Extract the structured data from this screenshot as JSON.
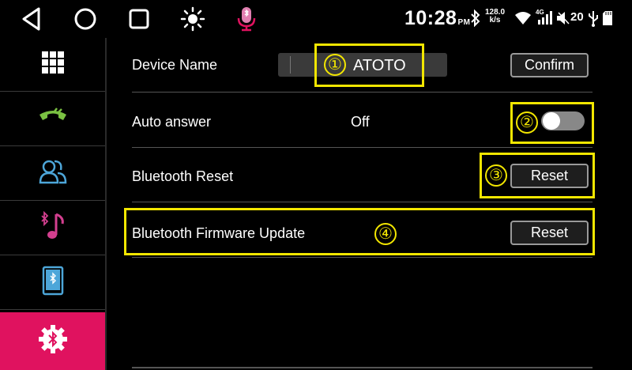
{
  "status_bar": {
    "time": "10:28",
    "ampm": "PM",
    "net_speed_value": "128.0",
    "net_speed_unit": "k/s",
    "signal_label": "4G",
    "volume": "20",
    "icons": [
      "back-icon",
      "home-icon",
      "recent-apps-icon",
      "brightness-icon",
      "bluetooth-mic-icon",
      "bluetooth-icon",
      "wifi-icon",
      "cell-signal-icon",
      "volume-icon",
      "usb-icon",
      "sd-card-icon"
    ]
  },
  "sidebar": {
    "items": [
      {
        "name": "dialpad",
        "icon": "dialpad-icon",
        "active": false
      },
      {
        "name": "call-log",
        "icon": "phone-call-icon",
        "active": false
      },
      {
        "name": "contacts",
        "icon": "contacts-icon",
        "active": false
      },
      {
        "name": "bt-music",
        "icon": "bluetooth-music-icon",
        "active": false
      },
      {
        "name": "device",
        "icon": "phone-bluetooth-icon",
        "active": false
      },
      {
        "name": "bt-settings",
        "icon": "bluetooth-settings-icon",
        "active": true
      }
    ],
    "active_color": "#e0125f"
  },
  "settings": {
    "device_name": {
      "label": "Device Name",
      "value": "ATOTO",
      "confirm_label": "Confirm",
      "marker": "①"
    },
    "auto_answer": {
      "label": "Auto answer",
      "value": "Off",
      "enabled": false,
      "marker": "②"
    },
    "bt_reset": {
      "label": "Bluetooth Reset",
      "button_label": "Reset",
      "marker": "③"
    },
    "fw_update": {
      "label": "Bluetooth Firmware Update",
      "button_label": "Reset",
      "marker": "④"
    }
  },
  "colors": {
    "highlight": "#f2e600",
    "accent": "#e0125f",
    "sidebar_icon_green": "#7ac142",
    "sidebar_icon_blue": "#4da6d9",
    "sidebar_icon_pink": "#d33f8f"
  }
}
